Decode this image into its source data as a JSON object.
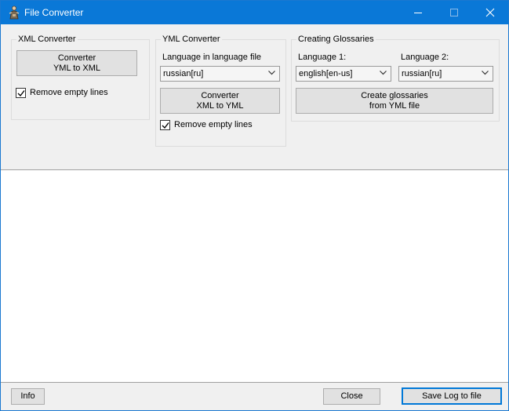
{
  "window": {
    "title": "File Converter"
  },
  "xml_converter": {
    "group_title": "XML Converter",
    "button_line1": "Converter",
    "button_line2": "YML to XML",
    "remove_empty_lines_label": "Remove empty lines",
    "remove_empty_lines_checked": true
  },
  "yml_converter": {
    "group_title": "YML Converter",
    "language_label": "Language in language file",
    "language_value": "russian[ru]",
    "button_line1": "Converter",
    "button_line2": "XML to YML",
    "remove_empty_lines_label": "Remove empty lines",
    "remove_empty_lines_checked": true
  },
  "glossaries": {
    "group_title": "Creating Glossaries",
    "language1_label": "Language 1:",
    "language1_value": "english[en-us]",
    "language2_label": "Language 2:",
    "language2_value": "russian[ru]",
    "button_line1": "Create glossaries",
    "button_line2": "from YML file"
  },
  "log": {
    "content": ""
  },
  "footer": {
    "info_label": "Info",
    "close_label": "Close",
    "save_log_label": "Save Log to file"
  },
  "colors": {
    "titlebar": "#0a78d7",
    "accent": "#0078d7"
  }
}
